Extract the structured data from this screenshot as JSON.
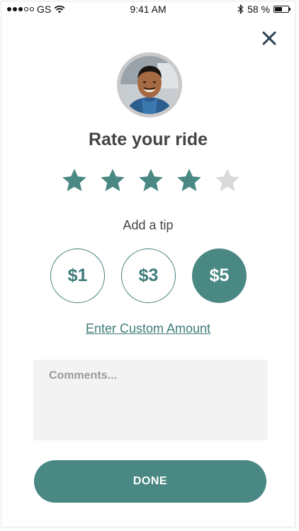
{
  "status_bar": {
    "carrier": "GS",
    "time": "9:41 AM",
    "battery_percent": "58 %",
    "battery_level": 0.58,
    "signal_bars_filled": 3,
    "signal_bars_total": 5
  },
  "header": {
    "close_icon": "close-icon"
  },
  "driver": {
    "avatar_icon": "driver-avatar"
  },
  "rating": {
    "title": "Rate your ride",
    "value": 4,
    "max": 5,
    "active_color": "#4a8884",
    "inactive_color": "#d9d9d9"
  },
  "tip": {
    "label": "Add a tip",
    "options": [
      {
        "label": "$1",
        "selected": false
      },
      {
        "label": "$3",
        "selected": false
      },
      {
        "label": "$5",
        "selected": true
      }
    ],
    "custom_link": "Enter Custom Amount"
  },
  "comments": {
    "placeholder": "Comments..."
  },
  "actions": {
    "done_label": "DONE"
  },
  "colors": {
    "accent": "#4a8884",
    "accent_text": "#3e7c79"
  }
}
